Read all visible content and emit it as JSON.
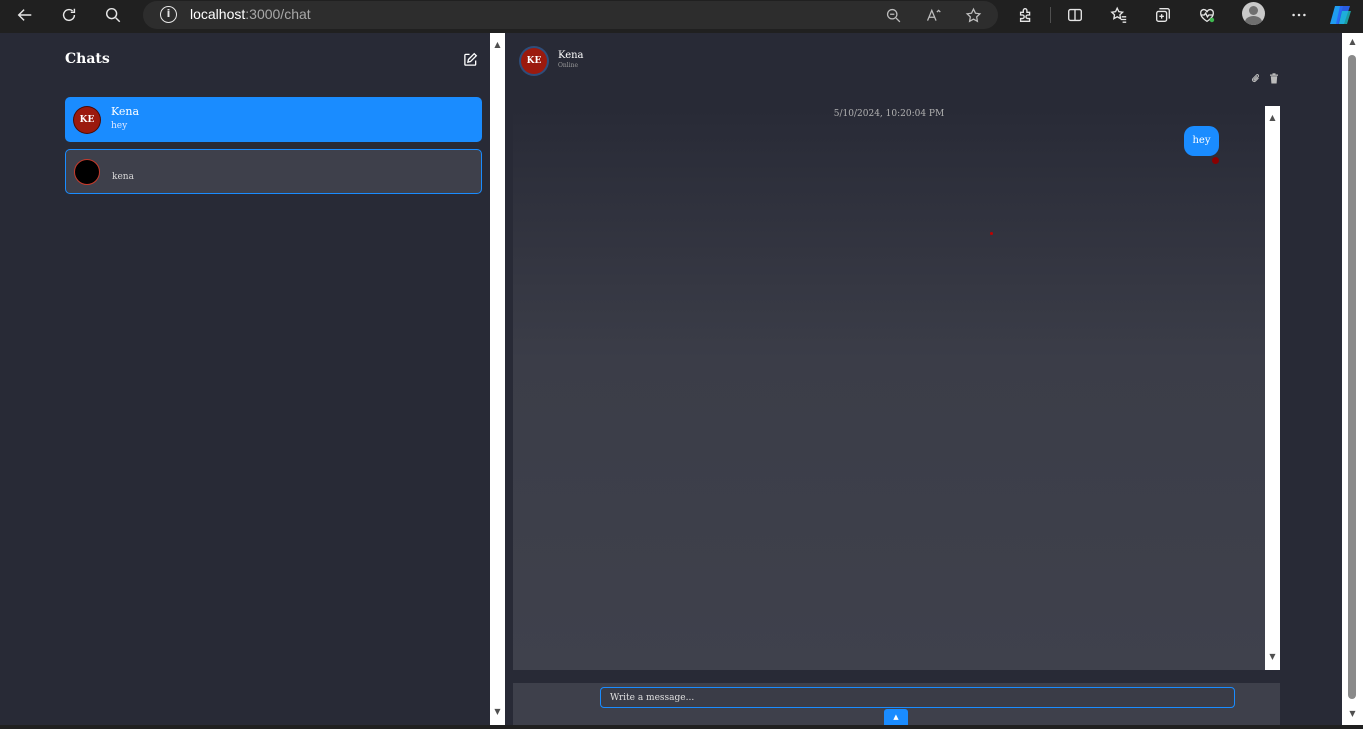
{
  "browser": {
    "url_host": "localhost",
    "url_path": ":3000/chat",
    "icons": [
      "back-icon",
      "refresh-icon",
      "search-icon",
      "info-icon",
      "zoom-out-icon",
      "read-aloud-icon",
      "favorite-star-icon",
      "extensions-icon",
      "split-screen-icon",
      "favorites-icon",
      "collections-icon",
      "browser-essentials-icon",
      "profile-icon",
      "more-icon",
      "copilot-icon"
    ]
  },
  "sidebar": {
    "title": "Chats",
    "compose_icon": "edit-icon",
    "chats": [
      {
        "initials": "KE",
        "name": "Kena",
        "preview": "hey",
        "active": true
      },
      {
        "initials": "",
        "name": "",
        "preview": "kena",
        "active": false
      }
    ]
  },
  "chat": {
    "contact_initials": "KE",
    "contact_name": "Kena",
    "contact_status": "Online",
    "actions": [
      "attach-icon",
      "delete-icon"
    ],
    "date_stamp": "5/10/2024, 10:20:04 PM",
    "messages": [
      {
        "text": "hey",
        "sent": true
      }
    ],
    "input_placeholder": "Write a message...",
    "input_value": "",
    "send_icon": "arrow-up-icon"
  },
  "colors": {
    "accent": "#1a8cff",
    "background": "#282a36",
    "avatar": "#9b1a0e"
  }
}
